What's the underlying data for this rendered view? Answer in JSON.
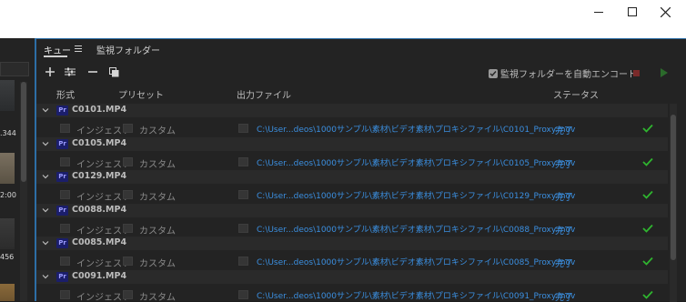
{
  "window": {
    "controls": [
      "minimize-icon",
      "maximize-icon",
      "close-icon"
    ]
  },
  "left_panel": {
    "labels": [
      ".344",
      "2:00",
      "456"
    ]
  },
  "tabs": {
    "queue": "キュー",
    "watch_folders": "監視フォルダー"
  },
  "toolbar": {
    "icons": [
      "plus-icon",
      "sliders-icon",
      "minus-icon",
      "duplicate-icon"
    ],
    "auto_encode_label": "監視フォルダーを自動エンコード",
    "auto_encode_checked": true
  },
  "columns": {
    "format": "形式",
    "preset": "プリセット",
    "output": "出力ファイル",
    "status": "ステータス"
  },
  "queue": [
    {
      "source": "C0101.MP4",
      "format": "インジェスト",
      "preset": "カスタム",
      "output": "C:\\User...deos\\1000サンプル\\素材\\ビデオ素材\\プロキシファイル\\C0101_Proxy.mov",
      "status": "完了"
    },
    {
      "source": "C0105.MP4",
      "format": "インジェスト",
      "preset": "カスタム",
      "output": "C:\\User...deos\\1000サンプル\\素材\\ビデオ素材\\プロキシファイル\\C0105_Proxy.mov",
      "status": "完了"
    },
    {
      "source": "C0129.MP4",
      "format": "インジェスト",
      "preset": "カスタム",
      "output": "C:\\User...deos\\1000サンプル\\素材\\ビデオ素材\\プロキシファイル\\C0129_Proxy.mov",
      "status": "完了"
    },
    {
      "source": "C0088.MP4",
      "format": "インジェスト",
      "preset": "カスタム",
      "output": "C:\\User...deos\\1000サンプル\\素材\\ビデオ素材\\プロキシファイル\\C0088_Proxy.mov",
      "status": "完了"
    },
    {
      "source": "C0085.MP4",
      "format": "インジェスト",
      "preset": "カスタム",
      "output": "C:\\User...deos\\1000サンプル\\素材\\ビデオ素材\\プロキシファイル\\C0085_Proxy.mov",
      "status": "完了"
    },
    {
      "source": "C0091.MP4",
      "format": "インジェスト",
      "preset": "カスタム",
      "output": "C:\\User...deos\\1000サンプル\\素材\\ビデオ素材\\プロキシファイル\\C0091_Proxy.mov",
      "status": "完了"
    }
  ],
  "badge_text": "Pr",
  "colors": {
    "accent_blue": "#3b8fe0",
    "done_green": "#2fb52f",
    "panel_bg": "#232323",
    "premiere_badge": "#1b1e6b"
  }
}
